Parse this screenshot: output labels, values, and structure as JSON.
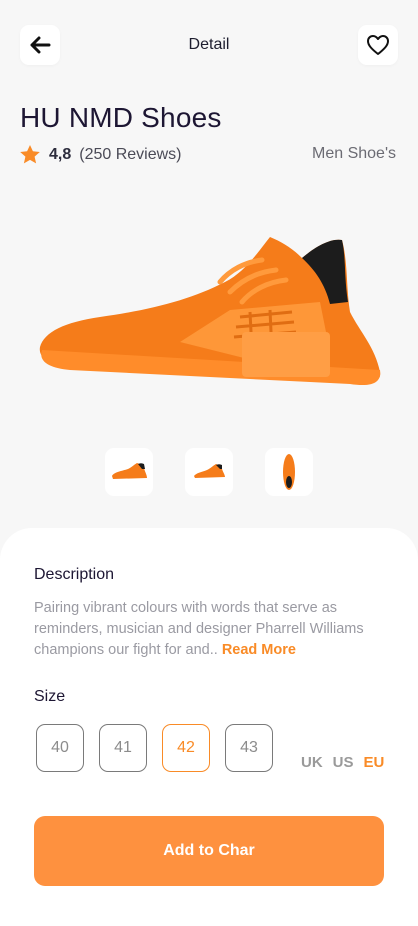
{
  "header": {
    "title": "Detail",
    "back_icon": "arrow-left-icon",
    "favorite_icon": "heart-icon"
  },
  "product": {
    "name": "HU NMD Shoes",
    "rating": "4,8",
    "reviews": "(250 Reviews)",
    "category": "Men Shoe's",
    "color": "#f98b27"
  },
  "thumbnails": [
    "side-view",
    "side-view-small",
    "top-view"
  ],
  "description": {
    "heading": "Description",
    "text": "Pairing vibrant colours with words that serve as reminders, musician and designer Pharrell Williams champions our fight for and.. ",
    "read_more": "Read More"
  },
  "size": {
    "heading": "Size",
    "options": [
      "40",
      "41",
      "42",
      "43"
    ],
    "selected": "42",
    "units": [
      "UK",
      "US",
      "EU"
    ],
    "selected_unit": "EU"
  },
  "cta": {
    "label": "Add to Char"
  },
  "colors": {
    "accent": "#f98b27",
    "button": "#fe913f"
  }
}
